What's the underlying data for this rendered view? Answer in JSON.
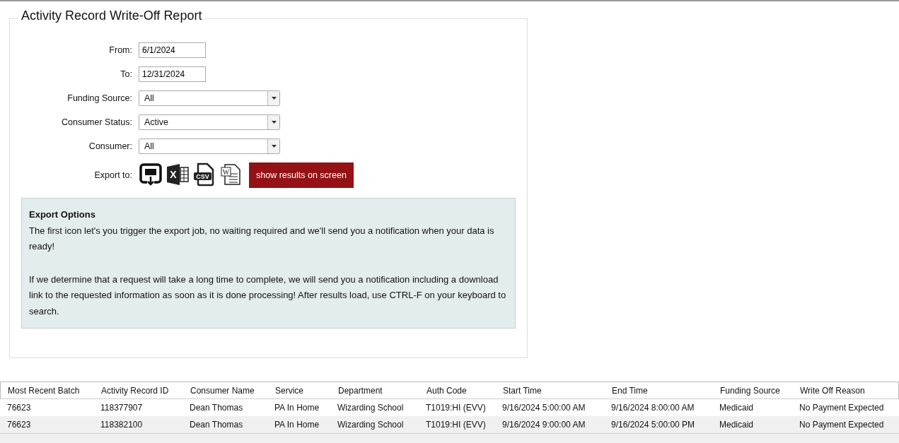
{
  "title": "Activity Record Write-Off Report",
  "fields": [
    {
      "label": "From:",
      "kind": "text",
      "value": "6/1/2024"
    },
    {
      "label": "To:",
      "kind": "text",
      "value": "12/31/2024"
    },
    {
      "label": "Funding Source:",
      "kind": "select",
      "value": "All"
    },
    {
      "label": "Consumer Status:",
      "kind": "select",
      "value": "Active"
    },
    {
      "label": "Consumer:",
      "kind": "select",
      "value": "All"
    }
  ],
  "export": {
    "label": "Export to:",
    "icons": [
      {
        "kind": "job"
      },
      {
        "kind": "excel",
        "glyph": "X"
      },
      {
        "kind": "csv",
        "glyph": "CSV"
      },
      {
        "kind": "word",
        "glyph": "W"
      }
    ],
    "button": "show results on screen"
  },
  "info": {
    "heading": "Export Options",
    "paragraphs": [
      "The first icon let's you trigger the export job, no waiting required and we'll send you a notification when your data is ready!",
      "If we determine that a request will take a long time to complete, we will send you a notification including a download link to the requested information as soon as it is done processing! After results load, use CTRL-F on your keyboard to search."
    ]
  },
  "table": {
    "columns": [
      "Most Recent Batch",
      "Activity Record ID",
      "Consumer Name",
      "Service",
      "Department",
      "Auth Code",
      "Start Time",
      "End Time",
      "Funding Source",
      "Write Off Reason"
    ],
    "rows": [
      [
        "76623",
        "118377907",
        "Dean Thomas",
        "PA In Home",
        "Wizarding School",
        "T1019:HI (EVV)",
        "9/16/2024 5:00:00 AM",
        "9/16/2024 8:00:00 AM",
        "Medicaid",
        "No Payment Expected"
      ],
      [
        "76623",
        "118382100",
        "Dean Thomas",
        "PA In Home",
        "Wizarding School",
        "T1019:HI (EVV)",
        "9/16/2024 9:00:00 AM",
        "9/16/2024 5:00:00 PM",
        "Medicaid",
        "No Payment Expected"
      ]
    ]
  }
}
